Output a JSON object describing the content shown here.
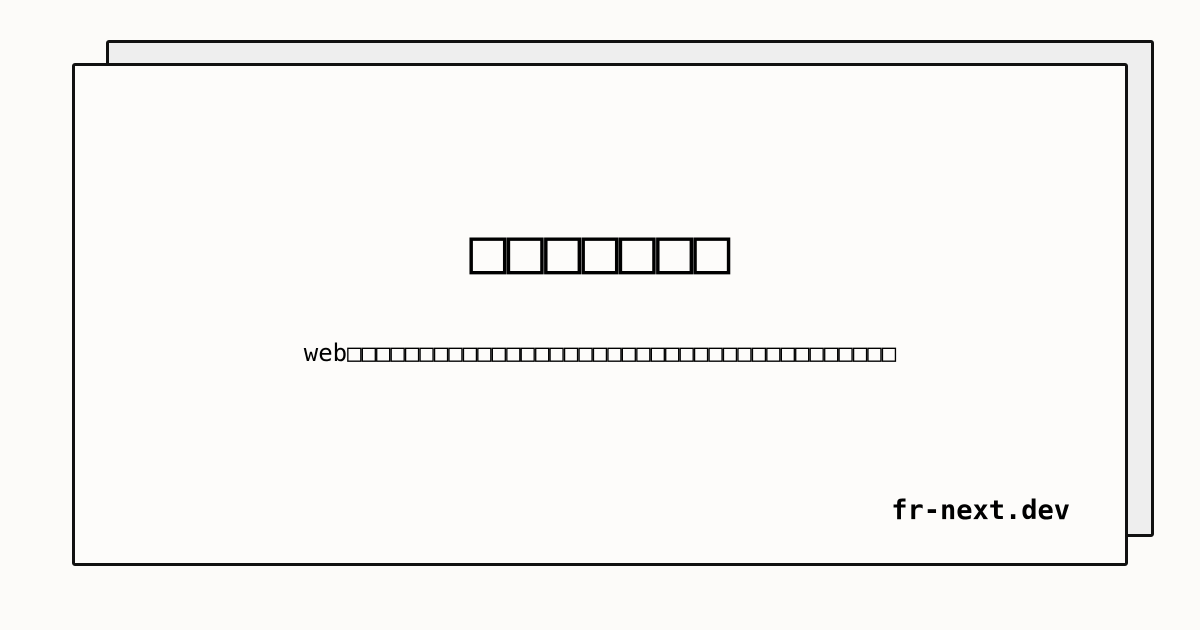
{
  "card": {
    "title": "□□□□□□□",
    "subtitle": "web□□□□□□□□□□□□□□□□□□□□□□□□□□□□□□□□□□□□□□",
    "site": "fr-next.dev"
  },
  "colors": {
    "background": "#fcfbf9",
    "card": "#fdfcfa",
    "shadow_card": "#eeeeee",
    "border": "#111111",
    "text": "#000000"
  }
}
